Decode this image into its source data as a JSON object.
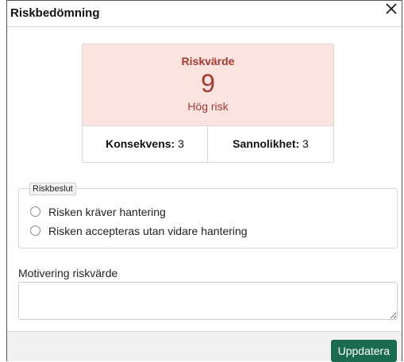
{
  "dialog": {
    "title": "Riskbedömning",
    "close_icon": "close-icon"
  },
  "risk": {
    "label": "Riskvärde",
    "value": "9",
    "level": "Hög risk",
    "consequence_label": "Konsekvens:",
    "consequence_value": "3",
    "probability_label": "Sannolikhet:",
    "probability_value": "3"
  },
  "decision": {
    "legend": "Riskbeslut",
    "options": [
      {
        "label": "Risken kräver hantering",
        "selected": false
      },
      {
        "label": "Risken accepteras utan vidare hantering",
        "selected": false
      }
    ]
  },
  "motivation": {
    "label": "Motivering riskvärde",
    "value": ""
  },
  "footer": {
    "update_label": "Uppdatera"
  },
  "colors": {
    "risk_background": "#fbe3e0",
    "risk_text": "#a33a2e",
    "primary_button": "#1c6b50"
  }
}
